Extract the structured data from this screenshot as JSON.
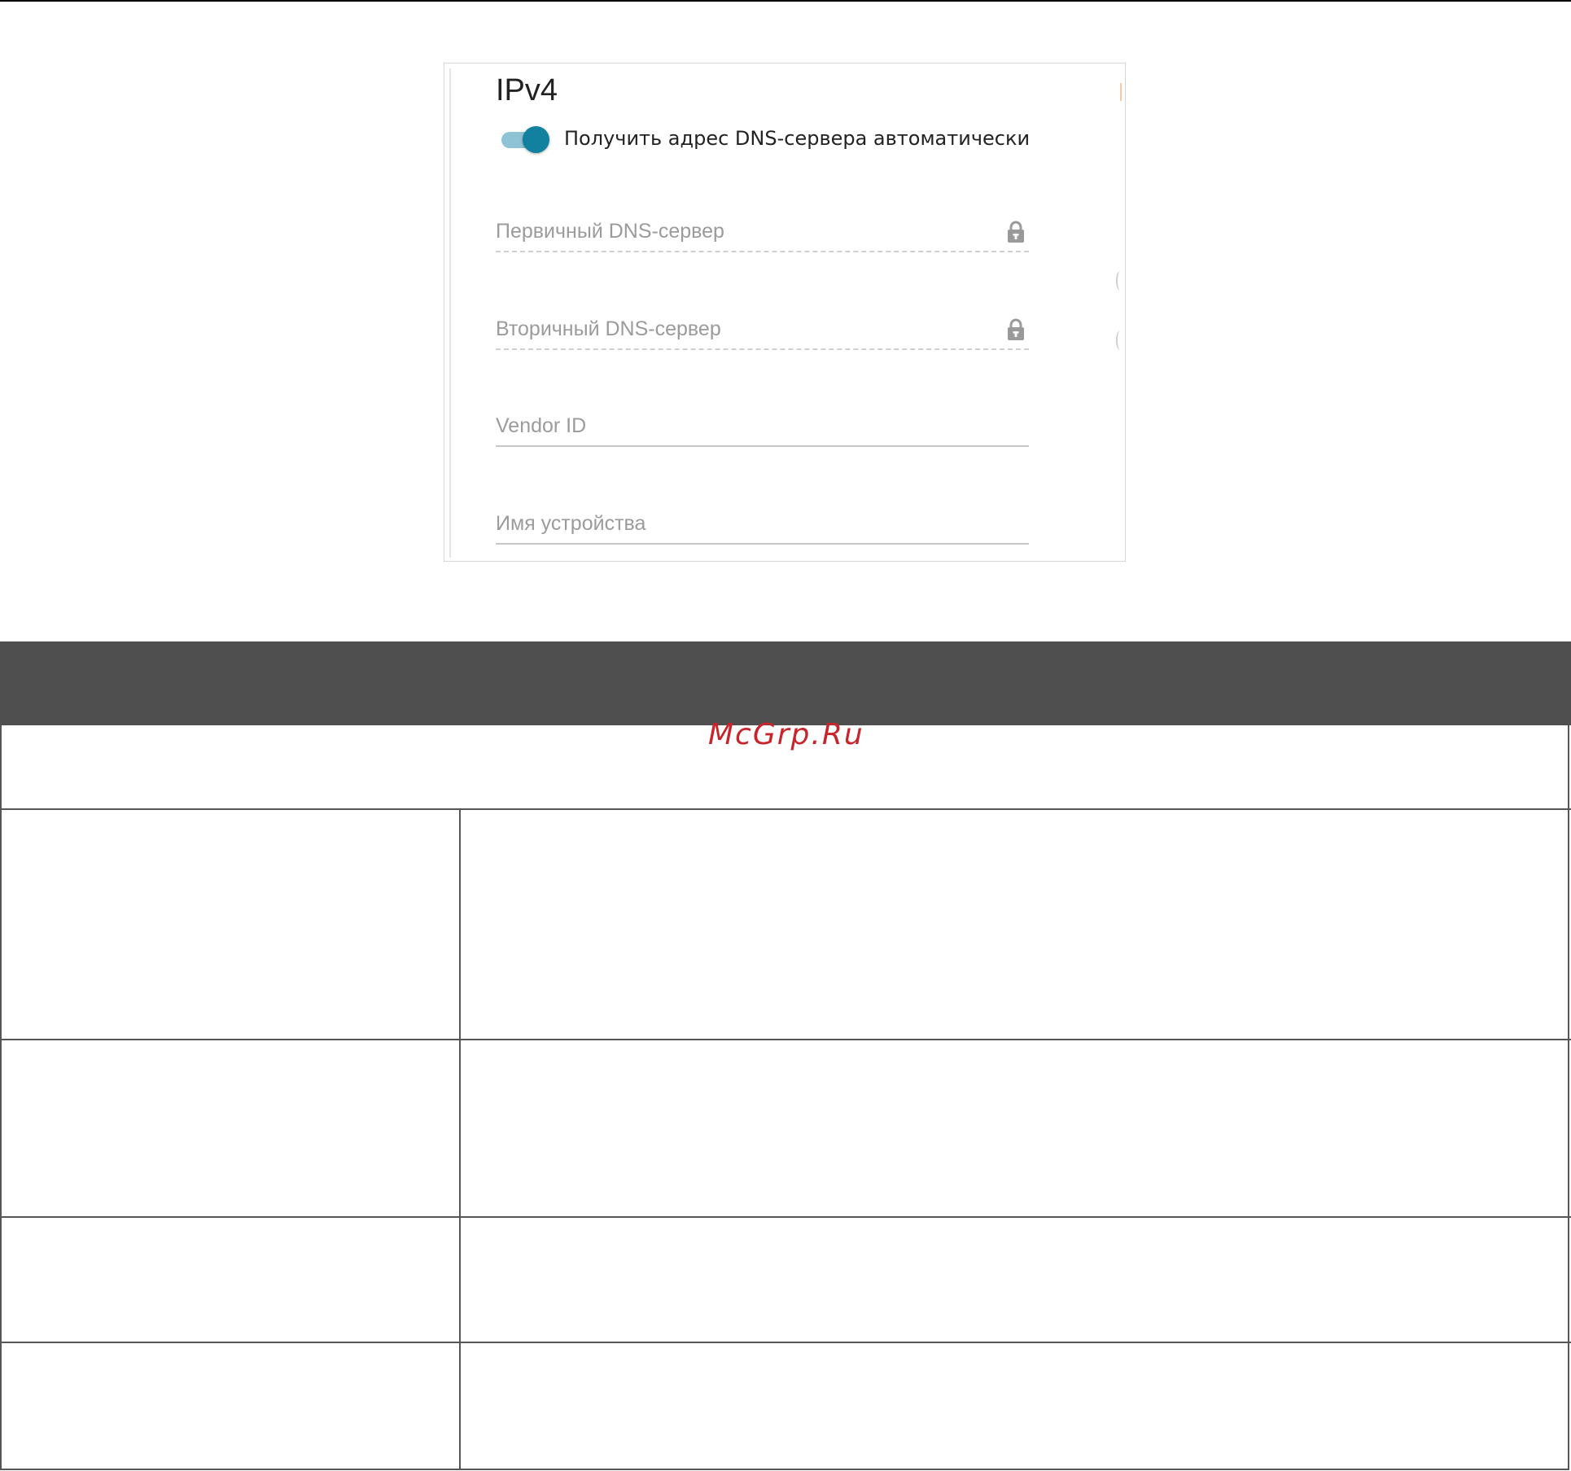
{
  "panel": {
    "title": "IPv4",
    "dns_auto_toggle": {
      "label": "Получить адрес DNS-сервера автоматически",
      "state": "on",
      "track_color": "#8ec3d6",
      "knob_color": "#12809f"
    },
    "fields": [
      {
        "placeholder": "Первичный DNS-сервер",
        "value": "",
        "locked": true,
        "icon": "lock-icon"
      },
      {
        "placeholder": "Вторичный DNS-сервер",
        "value": "",
        "locked": true,
        "icon": "lock-icon"
      },
      {
        "placeholder": "Vendor ID",
        "value": "",
        "locked": false
      },
      {
        "placeholder": "Имя устройства",
        "value": "",
        "locked": false
      }
    ]
  },
  "watermark": "McGrp.Ru",
  "table": {
    "header_color": "#4f4f4f",
    "watermark_color": "#c8242b",
    "rows": [
      {
        "type": "full-width",
        "cells": [
          ""
        ]
      },
      {
        "type": "two-column",
        "cells": [
          "",
          ""
        ]
      },
      {
        "type": "two-column",
        "cells": [
          "",
          ""
        ]
      },
      {
        "type": "two-column",
        "cells": [
          "",
          ""
        ]
      },
      {
        "type": "two-column",
        "cells": [
          "",
          ""
        ]
      }
    ]
  }
}
